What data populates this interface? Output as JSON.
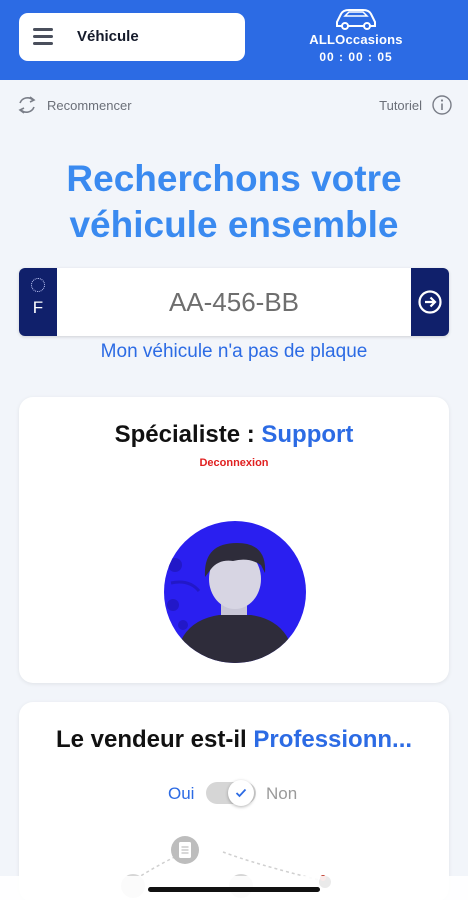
{
  "header": {
    "menu_title": "Véhicule",
    "brand_name": "ALLOccasions",
    "timer": "00 : 00 : 05",
    "color": "#2c6be4"
  },
  "toolbar": {
    "restart_label": "Recommencer",
    "tutorial_label": "Tutoriel"
  },
  "hero": {
    "line1": "Recherchons votre",
    "line2": "véhicule ensemble"
  },
  "plate": {
    "country": "F",
    "placeholder": "AA-456-BB",
    "no_plate_link": "Mon véhicule n'a pas de plaque"
  },
  "specialist": {
    "title_prefix": "Spécialiste : ",
    "title_accent": "Support",
    "logout_label": "Deconnexion"
  },
  "seller": {
    "title_prefix": "Le vendeur est-il ",
    "title_accent": "Professionn...",
    "yes_label": "Oui",
    "no_label": "Non",
    "toggle_on": true
  },
  "icons": [
    "menu-icon",
    "car-icon",
    "refresh-icon",
    "info-icon",
    "arrow-right-icon",
    "check-icon",
    "document-icon"
  ]
}
